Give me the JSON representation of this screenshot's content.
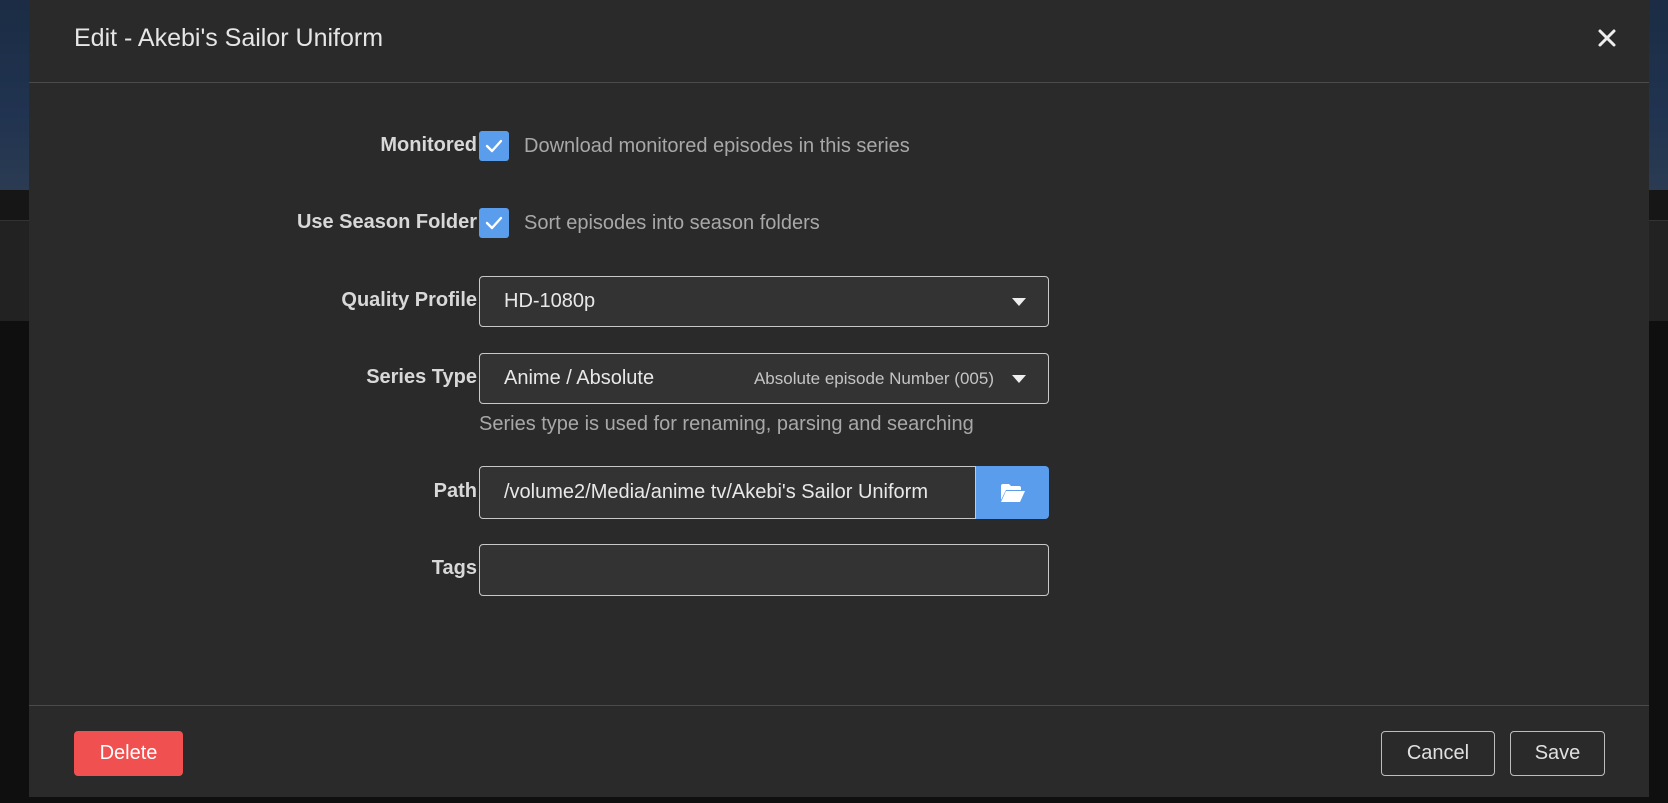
{
  "modal": {
    "title": "Edit - Akebi's Sailor Uniform",
    "close_icon": "close-icon"
  },
  "form": {
    "monitored": {
      "label": "Monitored",
      "checked": true,
      "help": "Download monitored episodes in this series"
    },
    "season_folder": {
      "label": "Use Season Folder",
      "checked": true,
      "help": "Sort episodes into season folders"
    },
    "quality_profile": {
      "label": "Quality Profile",
      "value": "HD-1080p"
    },
    "series_type": {
      "label": "Series Type",
      "value": "Anime / Absolute",
      "hint": "Absolute episode Number (005)",
      "help": "Series type is used for renaming, parsing and searching"
    },
    "path": {
      "label": "Path",
      "value": "/volume2/Media/anime tv/Akebi's Sailor Uniform",
      "browse_icon": "folder-open-icon"
    },
    "tags": {
      "label": "Tags",
      "value": ""
    }
  },
  "footer": {
    "delete_label": "Delete",
    "cancel_label": "Cancel",
    "save_label": "Save"
  },
  "colors": {
    "accent": "#5b9ded",
    "danger": "#f05050",
    "modal_bg": "#2a2a2a"
  }
}
